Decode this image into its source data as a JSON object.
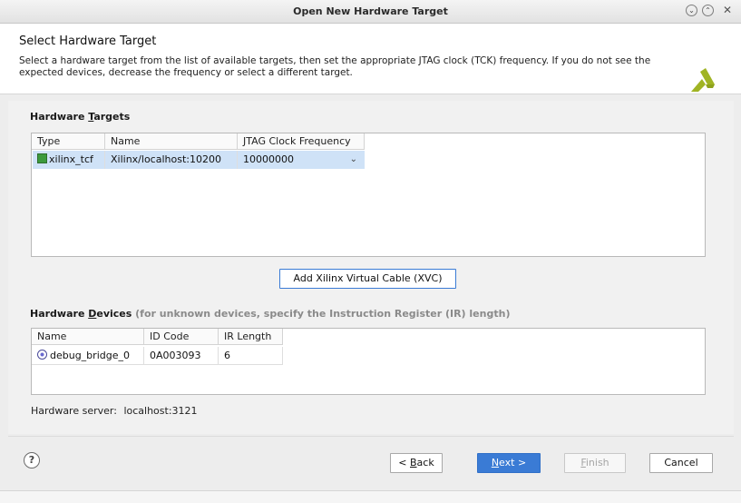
{
  "window": {
    "title": "Open New Hardware Target"
  },
  "header": {
    "title": "Select Hardware Target",
    "description": "Select a hardware target from the list of available targets, then set the appropriate JTAG clock (TCK) frequency. If you do not see the expected devices, decrease the frequency or select a different target."
  },
  "targets": {
    "section_title_pre": "Hardware ",
    "section_title_key": "T",
    "section_title_post": "argets",
    "columns": [
      "Type",
      "Name",
      "JTAG Clock Frequency"
    ],
    "rows": [
      {
        "type": "xilinx_tcf",
        "name": "Xilinx/localhost:10200",
        "frequency": "10000000"
      }
    ]
  },
  "xvc_button": "Add Xilinx Virtual Cable (XVC)",
  "devices": {
    "section_title_pre": "Hardware ",
    "section_title_key": "D",
    "section_title_post": "evices",
    "section_note": "(for unknown devices, specify the Instruction Register (IR) length)",
    "columns": [
      "Name",
      "ID Code",
      "IR Length"
    ],
    "rows": [
      {
        "name": "debug_bridge_0",
        "id_code": "0A003093",
        "ir_length": "6"
      }
    ]
  },
  "server": {
    "label": "Hardware server:",
    "value": "localhost:3121"
  },
  "buttons": {
    "back_pre": "< ",
    "back_key": "B",
    "back_post": "ack",
    "next_key": "N",
    "next_post": "ext >",
    "finish_key": "F",
    "finish_post": "inish",
    "cancel": "Cancel"
  },
  "help": "?",
  "colors": {
    "accent": "#3a7bd5",
    "logo": "#a0b424",
    "selection": "#cfe2f7"
  }
}
